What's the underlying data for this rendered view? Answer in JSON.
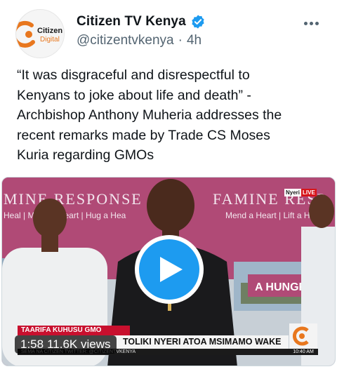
{
  "author": {
    "display_name": "Citizen TV Kenya",
    "handle": "@citizentvkenya",
    "separator": "·",
    "time_ago": "4h",
    "avatar_logo_text_line1": "Citizen",
    "avatar_logo_text_line2": "Digital"
  },
  "tweet": {
    "text": "“It was disgraceful and disrespectful to\nKenyans to joke about life and death” -\nArchbishop Anthony Muheria addresses the\nrecent remarks made by Trade CS Moses\nKuria regarding GMOs"
  },
  "video": {
    "banner_left_text": "MINE RESPONSE",
    "banner_left_sub": "Heal | Mend a Heart | Hug a Hea",
    "banner_right_text": "FAMINE RESP",
    "banner_right_sub": "Mend a Heart | Lift a Heart |",
    "backdrop_text": "A HUNGRY F",
    "live_location": "Nyeri",
    "live_label": "LIVE",
    "topic": "TAARIFA KUHUSU GMO",
    "headline": "TOLIKI NYERI ATOA MSIMAMO WAKE",
    "ticker": "SEMA NA CITIZEN TWITTER: @CITIZENTVKENYA",
    "clock": "10:40 AM",
    "duration": "1:58",
    "views": "11.6K views"
  },
  "colors": {
    "accent_blue": "#1d9bf0",
    "brand_red": "#c8102e",
    "banner_pink": "#b24f79",
    "secondary_text": "#536471"
  },
  "icons": {
    "verified": "verified-badge-icon",
    "more": "more-horizontal-icon",
    "play": "play-icon"
  }
}
